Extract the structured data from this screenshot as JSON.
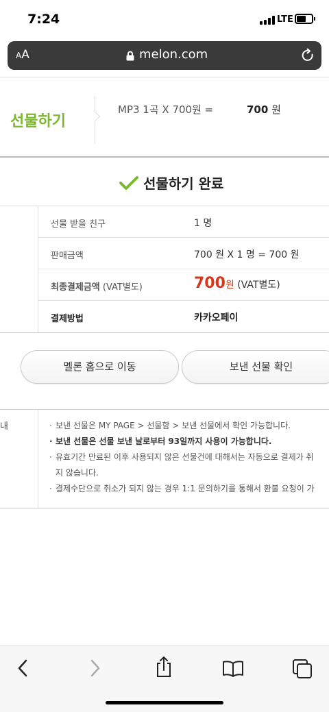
{
  "status": {
    "time": "7:24",
    "network": "LTE",
    "battery_level": 0.6
  },
  "browser": {
    "aa_label": "AA",
    "url": "melon.com"
  },
  "gift": {
    "title": "선물하기",
    "calc": "MP3 1곡 X 700원 =",
    "total_value": "700",
    "total_unit": "원"
  },
  "complete": {
    "title": "선물하기 완료"
  },
  "info": [
    {
      "label": "선물 받을 친구",
      "value": "1 명"
    },
    {
      "label": "판매금액",
      "value": "700 원 X 1 명 = 700 원"
    },
    {
      "label": "최종결제금액",
      "label_suffix": "(VAT별도)",
      "price": "700",
      "price_unit": "원",
      "price_vat": "(VAT별도)"
    },
    {
      "label": "결제방법",
      "value": "카카오페이"
    }
  ],
  "buttons": {
    "home": "멜론 홈으로 이동",
    "confirm": "보낸 선물 확인"
  },
  "notice": {
    "label": "내",
    "items": [
      "보낸 선물은 MY PAGE > 선물함 > 보낸 선물에서 확인 가능합니다.",
      "보낸 선물은 선물 보낸 날로부터 93일까지 사용이 가능합니다.",
      "유효기간 만료된 이후 사용되지 않은 선물건에 대해서는 자동으로 결제가 취",
      "지 않습니다.",
      "결제수단으로 취소가 되지 않는 경우 1:1 문의하기를 통해서 환불 요청이 가"
    ]
  },
  "toolbar": {
    "icons": [
      "back-icon",
      "forward-icon",
      "share-icon",
      "bookmarks-icon",
      "tabs-icon"
    ]
  },
  "colors": {
    "brand_green": "#7cb82f",
    "price_red": "#d6371d"
  }
}
